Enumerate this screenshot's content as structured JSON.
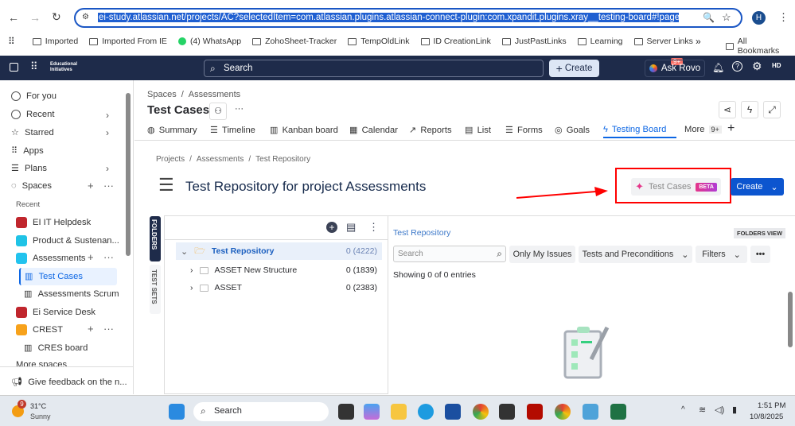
{
  "browser": {
    "url": "ei-study.atlassian.net/projects/AC?selectedItem=com.atlassian.plugins.atlassian-connect-plugin:com.xpandit.plugins.xray__testing-board#!page=test-reposit",
    "profile": "H",
    "bookmarks": [
      "Imported",
      "Imported From IE",
      "(4) WhatsApp",
      "ZohoSheet-Tracker",
      "TempOldLink",
      "ID CreationLink",
      "JustPastLinks",
      "Learning",
      "Server Links"
    ],
    "more": "»",
    "all_bookmarks": "All Bookmarks"
  },
  "topnav": {
    "logo": "Educational Initiatives",
    "search_placeholder": "Search",
    "create": "Create",
    "ask_rovo": "Ask Rovo",
    "notif_badge": "9+",
    "avatar": "HD"
  },
  "sidebar": {
    "items": [
      "For you",
      "Recent",
      "Starred",
      "Apps",
      "Plans",
      "Spaces"
    ],
    "recent_label": "Recent",
    "spaces": [
      "EI IT Helpdesk",
      "Product & Sustenan...",
      "Assessments",
      "Test Cases",
      "Assessments Scrum",
      "Ei Service Desk",
      "CREST",
      "CRES board",
      "More spaces"
    ],
    "feedback": "Give feedback on the n..."
  },
  "header": {
    "breadcrumb": [
      "Spaces",
      "Assessments"
    ],
    "title": "Test Cases",
    "more": "···",
    "tabs": [
      "Summary",
      "Timeline",
      "Kanban board",
      "Calendar",
      "Reports",
      "List",
      "Forms",
      "Goals",
      "Testing Board",
      "More"
    ],
    "more_badge": "9+"
  },
  "content": {
    "breadcrumb": [
      "Projects",
      "Assessments",
      "Test Repository"
    ],
    "title": "Test Repository for project Assessments",
    "ai_button": "Test Cases",
    "beta": "BETA",
    "create": "Create",
    "side_tabs": [
      "FOLDERS",
      "TEST SETS"
    ],
    "tree": [
      {
        "name": "Test Repository",
        "count": "0 (4222)"
      },
      {
        "name": "ASSET New Structure",
        "count": "0 (1839)"
      },
      {
        "name": "ASSET",
        "count": "0 (2383)"
      }
    ],
    "panel_title": "Test Repository",
    "folders_view": "FOLDERS VIEW",
    "search_placeholder": "Search",
    "only_my": "Only My Issues",
    "tests_pre": "Tests and Preconditions",
    "filters": "Filters",
    "showing": "Showing 0 of 0 entries"
  },
  "taskbar": {
    "temp": "31°C",
    "weather": "Sunny",
    "weather_badge": "9",
    "search": "Search",
    "time": "1:51 PM",
    "date": "10/8/2025"
  },
  "colors": {
    "nav": "#1e2b4a",
    "accent": "#0c66e4",
    "highlight": "#e9f2ff",
    "annotation": "#ff0000"
  }
}
